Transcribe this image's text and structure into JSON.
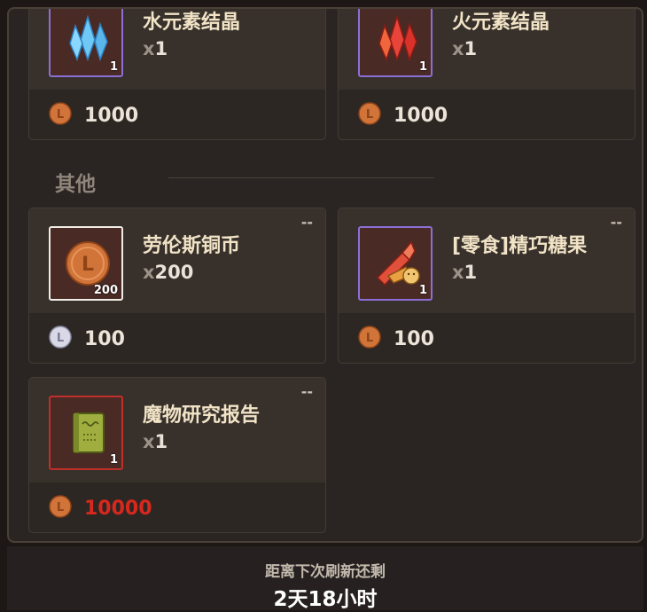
{
  "section": {
    "title": "其他"
  },
  "items": [
    {
      "name": "水元素结晶",
      "x": "x",
      "count": "1",
      "badge": "1",
      "price": "1000",
      "dash": ""
    },
    {
      "name": "火元素结晶",
      "x": "x",
      "count": "1",
      "badge": "1",
      "price": "1000",
      "dash": ""
    },
    {
      "name": "劳伦斯铜币",
      "x": "x",
      "count": "200",
      "badge": "200",
      "price": "100",
      "dash": "--"
    },
    {
      "name": "[零食]精巧糖果",
      "x": "x",
      "count": "1",
      "badge": "1",
      "price": "100",
      "dash": "--"
    },
    {
      "name": "魔物研究报告",
      "x": "x",
      "count": "1",
      "badge": "1",
      "price": "10000",
      "dash": "--"
    }
  ],
  "footer": {
    "label": "距离下次刷新还剩",
    "time": "2天18小时"
  },
  "colors": {
    "price_red": "#d8281e",
    "rare_border": "#8c6fd6",
    "epic_border": "#c0302a"
  },
  "icons": [
    "water-crystal-icon",
    "fire-crystal-icon",
    "copper-coin-icon",
    "candy-icon",
    "monster-report-book-icon",
    "copper-coin-currency-icon",
    "silver-coin-currency-icon"
  ]
}
